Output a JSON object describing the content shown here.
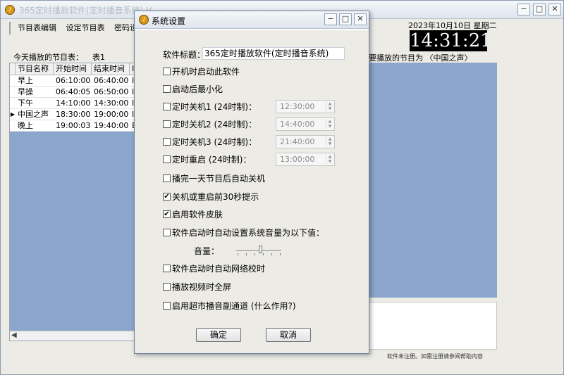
{
  "main": {
    "title": "365定时播放软件(定时播音系统) V...",
    "menu": [
      "节目表编辑",
      "设定节目表",
      "密码设置"
    ],
    "today_label": "今天播放的节目表：",
    "today_value": "表1",
    "table": {
      "headers": [
        "节目名称",
        "开始时间",
        "结束时间",
        "I"
      ],
      "rows": [
        {
          "marker": "",
          "name": "早上",
          "start": "06:10:00",
          "end": "06:40:00",
          "x": "I"
        },
        {
          "marker": "",
          "name": "早操",
          "start": "06:40:05",
          "end": "06:50:00",
          "x": "I"
        },
        {
          "marker": "",
          "name": "下午",
          "start": "14:10:00",
          "end": "14:30:00",
          "x": "I"
        },
        {
          "marker": "▶",
          "name": "中国之声",
          "start": "18:30:00",
          "end": "19:00:00",
          "x": "I"
        },
        {
          "marker": "",
          "name": "晚上",
          "start": "19:00:03",
          "end": "19:40:00",
          "x": "E"
        }
      ],
      "scroll_left": "◀"
    },
    "date": "2023年10月10日  星期二",
    "clock": "14:31:21",
    "next_program": "要播放的节目为 〈中国之声〉",
    "status": "软件未注册。如需注册请参阅帮助内容",
    "window_buttons": [
      "−",
      "□",
      "✕"
    ]
  },
  "dialog": {
    "title": "系统设置",
    "window_buttons": [
      "−",
      "□",
      "✕"
    ],
    "software_title_label": "软件标题：",
    "software_title_value": "365定时播放软件(定时播音系统)",
    "options": [
      {
        "label": "开机时启动此软件",
        "checked": false
      },
      {
        "label": "启动后最小化",
        "checked": false
      },
      {
        "label": "定时关机1 (24时制)：",
        "checked": false,
        "time": "12:30:00"
      },
      {
        "label": "定时关机2 (24时制)：",
        "checked": false,
        "time": "14:40:00"
      },
      {
        "label": "定时关机3 (24时制)：",
        "checked": false,
        "time": "21:40:00"
      },
      {
        "label": "定时重启  (24时制)：",
        "checked": false,
        "time": "13:00:00"
      },
      {
        "label": "播完一天节目后自动关机",
        "checked": false
      },
      {
        "label": "关机或重启前30秒提示",
        "checked": true
      },
      {
        "label": "启用软件皮肤",
        "checked": true
      },
      {
        "label": "软件启动时自动设置系统音量为以下值：",
        "checked": false
      },
      {
        "label": "软件启动时自动网络校时",
        "checked": false
      },
      {
        "label": "播放视频时全屏",
        "checked": false
      },
      {
        "label": "启用超市播音副通道  (什么作用?)",
        "checked": false
      }
    ],
    "volume_label": "音量：",
    "volume_level": 0.55,
    "ok_label": "确定",
    "cancel_label": "取消"
  }
}
